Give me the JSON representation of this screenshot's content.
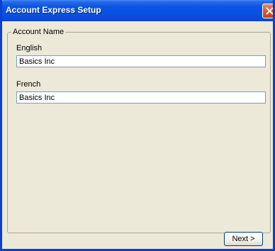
{
  "window": {
    "title": "Account Express Setup"
  },
  "account_name_group": {
    "legend": "Account Name",
    "english": {
      "label": "English",
      "value": "Basics Inc"
    },
    "french": {
      "label": "French",
      "value": "Basics Inc"
    }
  },
  "buttons": {
    "next_label": "Next >"
  },
  "icons": {
    "close": "close-icon"
  },
  "colors": {
    "titlebar": "#0b55e6",
    "window_bg": "#ece9d8",
    "close_button": "#e05a32",
    "input_border": "#7f9db9"
  }
}
